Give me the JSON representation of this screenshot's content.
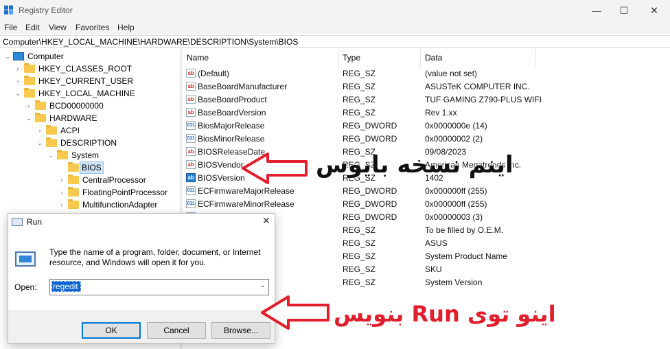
{
  "window": {
    "title": "Registry Editor",
    "controls": {
      "minimize": "—",
      "maximize": "☐",
      "close": "✕"
    }
  },
  "menu": [
    "File",
    "Edit",
    "View",
    "Favorites",
    "Help"
  ],
  "address": "Computer\\HKEY_LOCAL_MACHINE\\HARDWARE\\DESCRIPTION\\System\\BIOS",
  "tree": [
    {
      "label": "Computer",
      "toggle": "⌄",
      "icon": "computer-icon"
    },
    {
      "label": "HKEY_CLASSES_ROOT",
      "toggle": "›",
      "icon": "folder-icon"
    },
    {
      "label": "HKEY_CURRENT_USER",
      "toggle": "›",
      "icon": "folder-icon"
    },
    {
      "label": "HKEY_LOCAL_MACHINE",
      "toggle": "⌄",
      "icon": "folder-icon"
    },
    {
      "label": "BCD00000000",
      "toggle": "›",
      "icon": "folder-icon"
    },
    {
      "label": "HARDWARE",
      "toggle": "⌄",
      "icon": "folder-icon"
    },
    {
      "label": "ACPI",
      "toggle": "›",
      "icon": "folder-icon"
    },
    {
      "label": "DESCRIPTION",
      "toggle": "⌄",
      "icon": "folder-icon"
    },
    {
      "label": "System",
      "toggle": "⌄",
      "icon": "folder-icon"
    },
    {
      "label": "BIOS",
      "toggle": "",
      "icon": "folder-icon",
      "selected": true
    },
    {
      "label": "CentralProcessor",
      "toggle": "›",
      "icon": "folder-icon"
    },
    {
      "label": "FloatingPointProcessor",
      "toggle": "›",
      "icon": "folder-icon"
    },
    {
      "label": "MultifunctionAdapter",
      "toggle": "›",
      "icon": "folder-icon"
    }
  ],
  "list": {
    "columns": [
      "Name",
      "Type",
      "Data"
    ],
    "rows": [
      {
        "name": "(Default)",
        "type": "REG_SZ",
        "data": "(value not set)",
        "icon": "ab"
      },
      {
        "name": "BaseBoardManufacturer",
        "type": "REG_SZ",
        "data": "ASUSTeK COMPUTER INC.",
        "icon": "ab"
      },
      {
        "name": "BaseBoardProduct",
        "type": "REG_SZ",
        "data": "TUF GAMING Z790-PLUS WIFI",
        "icon": "ab"
      },
      {
        "name": "BaseBoardVersion",
        "type": "REG_SZ",
        "data": "Rev 1.xx",
        "icon": "ab"
      },
      {
        "name": "BiosMajorRelease",
        "type": "REG_DWORD",
        "data": "0x0000000e (14)",
        "icon": "011"
      },
      {
        "name": "BiosMinorRelease",
        "type": "REG_DWORD",
        "data": "0x00000002 (2)",
        "icon": "011"
      },
      {
        "name": "BIOSReleaseDate",
        "type": "REG_SZ",
        "data": "09/08/2023",
        "icon": "ab"
      },
      {
        "name": "BIOSVendor",
        "type": "REG_SZ",
        "data": "American Megatrends Inc.",
        "icon": "ab"
      },
      {
        "name": "BIOSVersion",
        "type": "REG_SZ",
        "data": "1402",
        "icon": "ab",
        "selected": true
      },
      {
        "name": "ECFirmwareMajorRelease",
        "type": "REG_DWORD",
        "data": "0x000000ff (255)",
        "icon": "011"
      },
      {
        "name": "ECFirmwareMinorRelease",
        "type": "REG_DWORD",
        "data": "0x000000ff (255)",
        "icon": "011"
      },
      {
        "name": "",
        "type": "REG_DWORD",
        "data": "0x00000003 (3)",
        "icon": "011"
      },
      {
        "name": "",
        "type": "REG_SZ",
        "data": "To be filled by O.E.M.",
        "icon": ""
      },
      {
        "name": "",
        "type": "REG_SZ",
        "data": "ASUS",
        "icon": ""
      },
      {
        "name": "",
        "type": "REG_SZ",
        "data": "System Product Name",
        "icon": ""
      },
      {
        "name": "",
        "type": "REG_SZ",
        "data": "SKU",
        "icon": ""
      },
      {
        "name": "",
        "type": "REG_SZ",
        "data": "System Version",
        "icon": ""
      }
    ]
  },
  "run": {
    "title": "Run",
    "close": "✕",
    "description": "Type the name of a program, folder, document, or Internet resource, and Windows will open it for you.",
    "open_label": "Open:",
    "input_value": "regedit",
    "buttons": {
      "ok": "OK",
      "cancel": "Cancel",
      "browse": "Browse..."
    }
  },
  "annotations": {
    "bios_note": "اینم نسخه بایوس",
    "run_note": "اینو توی Run بنویس",
    "colors": {
      "arrow": "#e01e2c",
      "note1": "#111111",
      "note2": "#e01e2c"
    }
  }
}
